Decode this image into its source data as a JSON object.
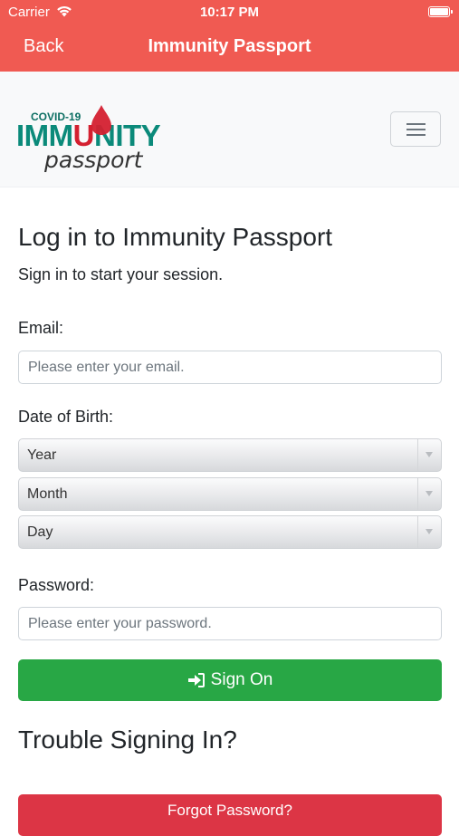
{
  "status_bar": {
    "carrier": "Carrier",
    "time": "10:17 PM"
  },
  "nav": {
    "back_label": "Back",
    "title": "Immunity Passport"
  },
  "logo": {
    "top_text": "COVID-19",
    "main_pre": "IMM",
    "main_drop": "U",
    "main_post": "NITY",
    "sub_text": "passport"
  },
  "page": {
    "title": "Log in to Immunity Passport",
    "subtitle": "Sign in to start your session."
  },
  "form": {
    "email_label": "Email:",
    "email_placeholder": "Please enter your email.",
    "dob_label": "Date of Birth:",
    "year_value": "Year",
    "month_value": "Month",
    "day_value": "Day",
    "password_label": "Password:",
    "password_placeholder": "Please enter your password.",
    "sign_on_label": "Sign On"
  },
  "trouble": {
    "heading": "Trouble Signing In?",
    "forgot_label": "Forgot Password?"
  },
  "colors": {
    "nav_bar": "#f05a52",
    "logo_teal": "#0b8a7a",
    "logo_red": "#d42030",
    "success": "#28a745",
    "danger": "#dc3545"
  }
}
